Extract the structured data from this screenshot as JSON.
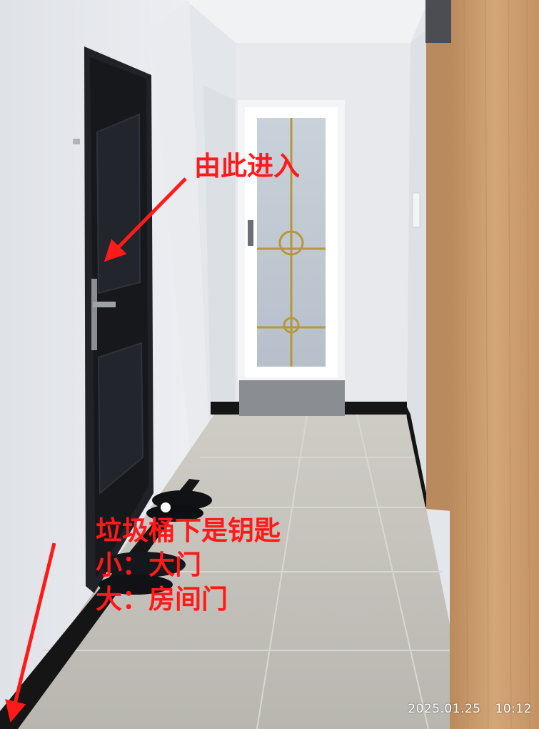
{
  "annotations": {
    "enter_here": "由此进入",
    "keys_lines": [
      "垃圾桶下是钥匙",
      "小：大门",
      "大：房间门"
    ]
  },
  "timestamp": {
    "date": "2025.01.25",
    "time": "10:12"
  },
  "colors": {
    "annotation": "#ff1a1a",
    "wall": "#e6e8ec",
    "floor": "#bfbdb7",
    "door_dark": "#1b1d22",
    "wood_panel": "#c99a6b"
  }
}
